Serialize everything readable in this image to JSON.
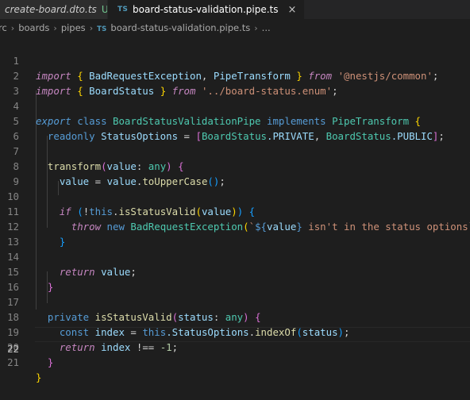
{
  "tabs": [
    {
      "name": "create-board.dto.ts",
      "flag": "U",
      "active": false
    },
    {
      "name": "board-status-validation.pipe.ts",
      "icon": "TS",
      "active": true
    }
  ],
  "breadcrumb": [
    "src",
    "boards",
    "pipes",
    "board-status-validation.pipe.ts",
    "..."
  ],
  "breadcrumb_icon": "TS",
  "line_numbers": [
    "1",
    "2",
    "3",
    "4",
    "5",
    "6",
    "7",
    "8",
    "9",
    "10",
    "11",
    "12",
    "13",
    "14",
    "15",
    "16",
    "17",
    "18",
    "19",
    "20",
    "21",
    "22"
  ],
  "code": {
    "l1": {
      "import": "import",
      "ob": "{",
      "c1": "BadRequestException",
      "comma": ",",
      "c2": "PipeTransform",
      "cb": "}",
      "from": "from",
      "str": "'@nestjs/common'",
      "semi": ";"
    },
    "l2": {
      "import": "import",
      "ob": "{",
      "c1": "BoardStatus",
      "cb": "}",
      "from": "from",
      "str": "'../board-status.enum'",
      "semi": ";"
    },
    "l4": {
      "export": "export",
      "class": "class",
      "name": "BoardStatusValidationPipe",
      "implements": "implements",
      "iface": "PipeTransform",
      "ob": "{"
    },
    "l5": {
      "readonly": "readonly",
      "prop": "StatusOptions",
      "eq": "=",
      "ob": "[",
      "t1": "BoardStatus",
      "m1": ".PRIVATE",
      "comma": ",",
      "t2": "BoardStatus",
      "m2": ".PUBLIC",
      "cb": "]",
      "semi": ";"
    },
    "l7": {
      "fn": "transform",
      "op": "(",
      "param": "value",
      "colon": ":",
      "type": "any",
      "cp": ")",
      "ob": "{"
    },
    "l8": {
      "v1": "value",
      "eq": "=",
      "v2": "value",
      "dot": ".",
      "fn": "toUpperCase",
      "parens": "()",
      "semi": ";"
    },
    "l10": {
      "if": "if",
      "op": "(",
      "not": "!",
      "this": "this",
      "dot": ".",
      "fn": "isStatusValid",
      "op2": "(",
      "arg": "value",
      "cp2": ")",
      "cp": ")",
      "ob": "{"
    },
    "l11": {
      "throw": "throw",
      "new": "new",
      "cls": "BadRequestException",
      "op": "(",
      "tpl_open": "`",
      "tpl_dollar": "${",
      "tpl_var": "value",
      "tpl_close_brace": "}",
      "tpl_text": " isn't in the status options",
      "tpl_end": "`",
      "cp": ")",
      "semi": ";"
    },
    "l12": {
      "cb": "}"
    },
    "l14": {
      "return": "return",
      "v": "value",
      "semi": ";"
    },
    "l15": {
      "cb": "}"
    },
    "l17": {
      "private": "private",
      "fn": "isStatusValid",
      "op": "(",
      "param": "status",
      "colon": ":",
      "type": "any",
      "cp": ")",
      "ob": "{"
    },
    "l18": {
      "const": "const",
      "v": "index",
      "eq": "=",
      "this": "this",
      "prop": ".StatusOptions",
      "dot": ".",
      "fn": "indexOf",
      "op": "(",
      "arg": "status",
      "cp": ")",
      "semi": ";"
    },
    "l19": {
      "return": "return",
      "v": "index",
      "op": "!==",
      "num": "-1",
      "semi": ";"
    },
    "l20": {
      "cb": "}"
    },
    "l21": {
      "cb": "}"
    }
  }
}
